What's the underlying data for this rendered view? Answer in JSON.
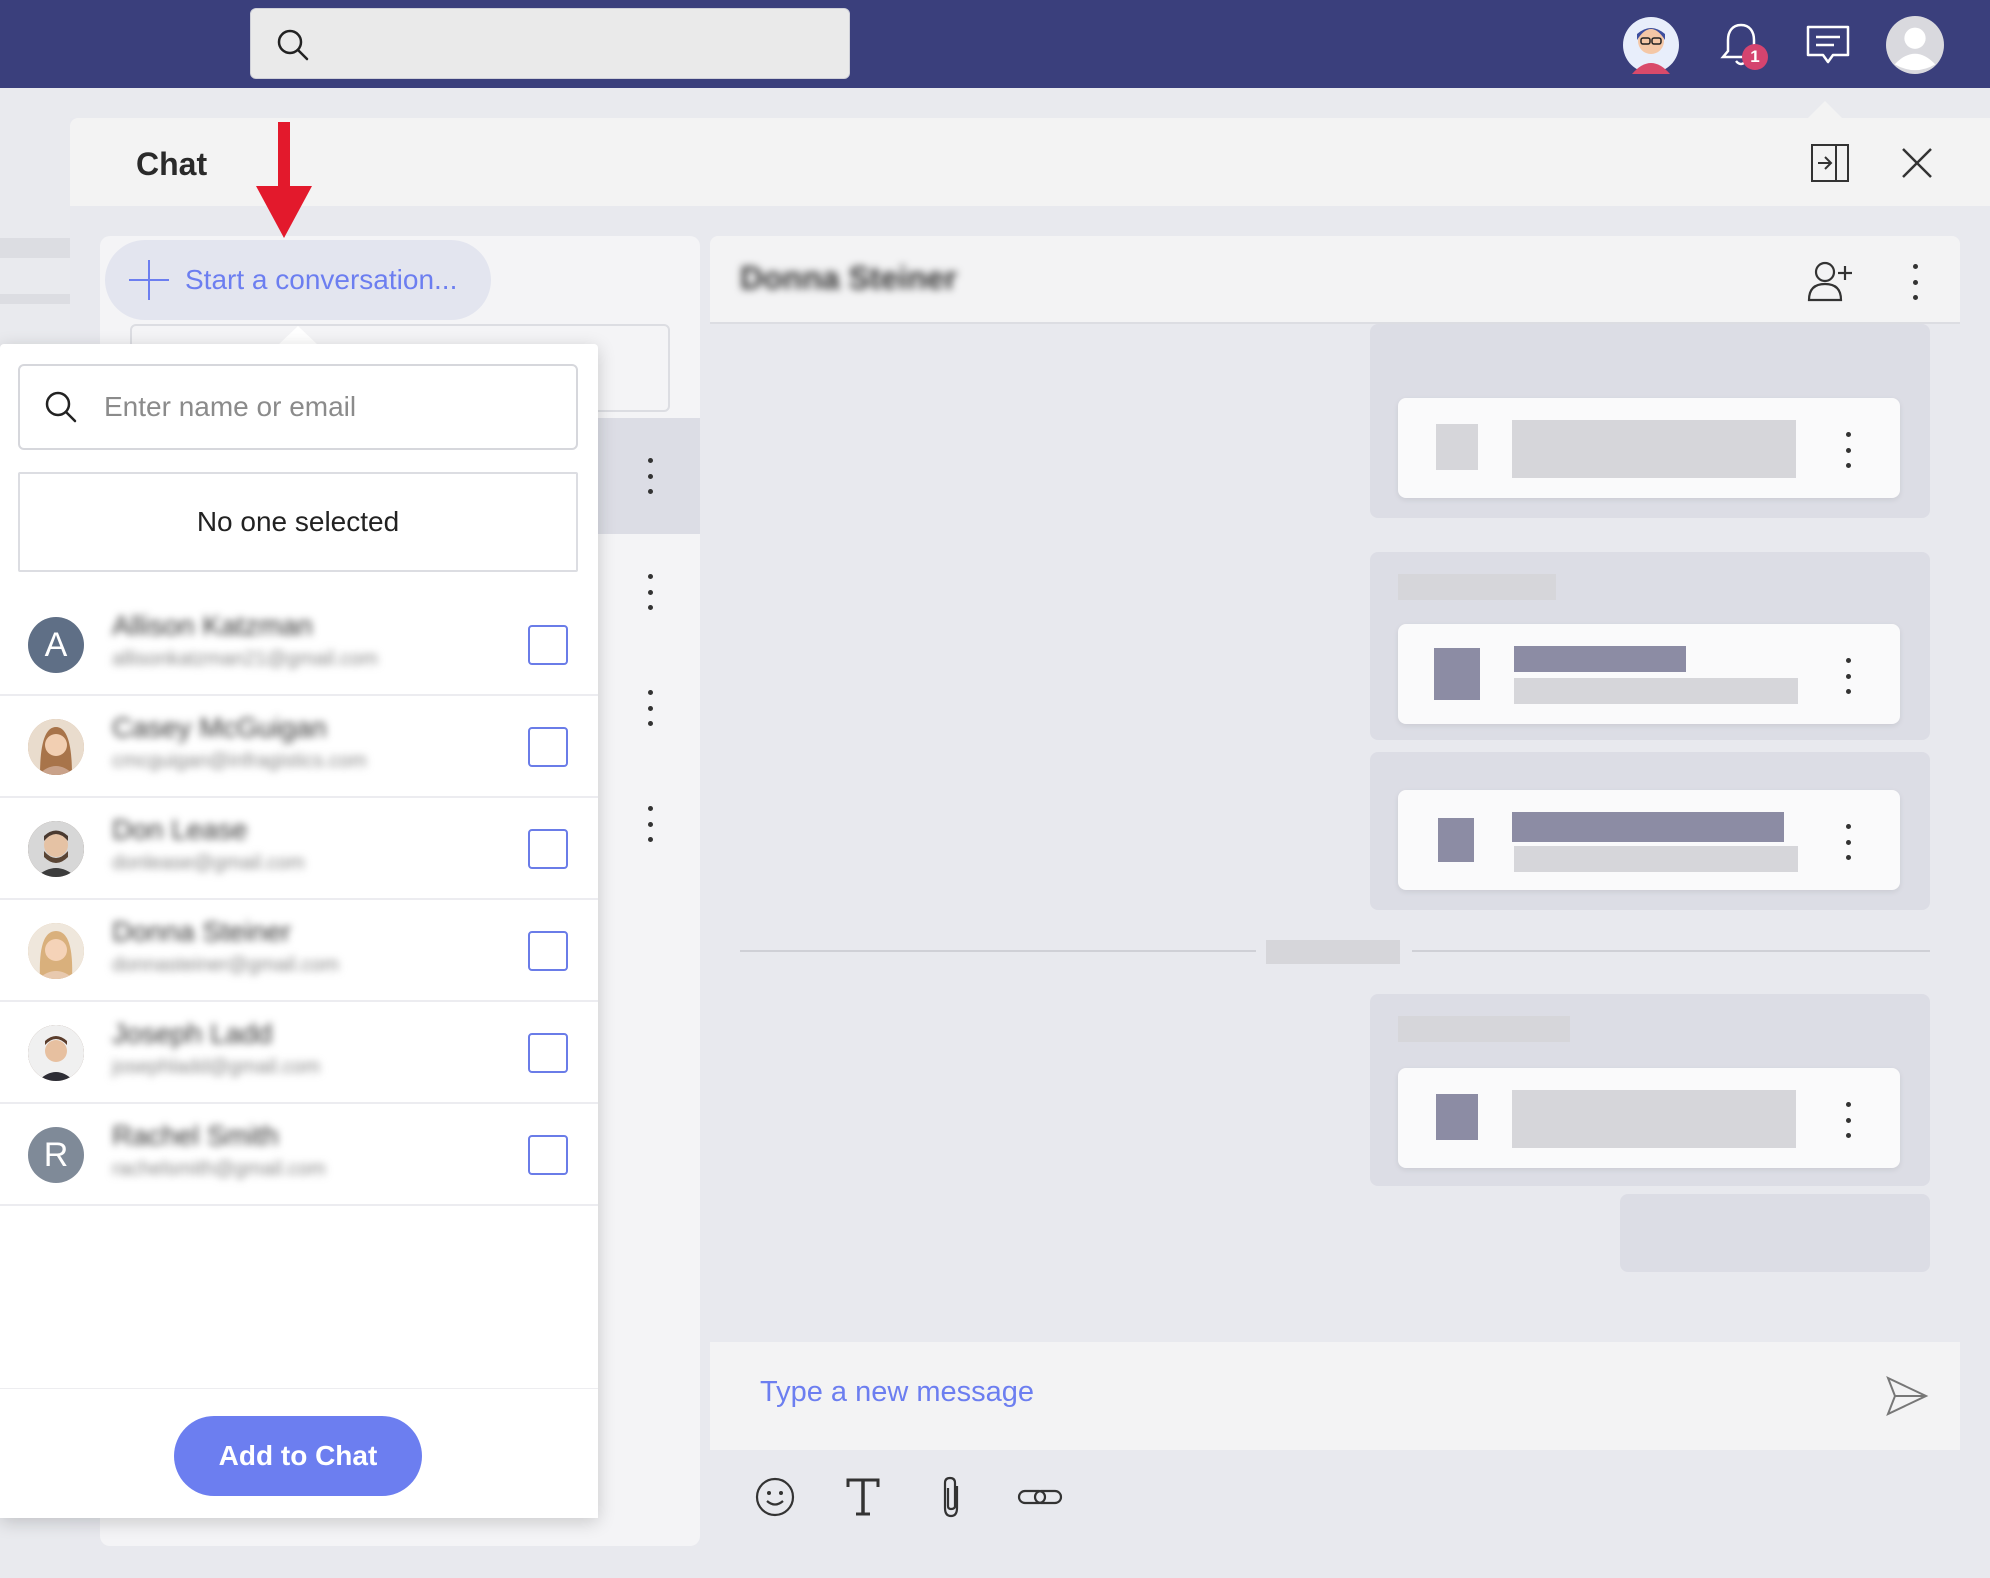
{
  "topbar": {
    "search_placeholder": "",
    "notification_count": "1"
  },
  "chat": {
    "title": "Chat",
    "start_conversation_label": "Start a conversation..."
  },
  "popup": {
    "search_placeholder": "Enter name or email",
    "no_one_selected": "No one selected",
    "contacts": [
      {
        "initial": "A",
        "name": "Allison Katzman",
        "email": "allisonkatzman21@gmail.com",
        "avatar_color": "#5f6f86"
      },
      {
        "initial": "",
        "name": "Casey McGuigan",
        "email": "cmcguigan@infragistics.com",
        "avatar_color": "#c89a72"
      },
      {
        "initial": "",
        "name": "Don Lease",
        "email": "donlease@gmail.com",
        "avatar_color": "#6d5b4e"
      },
      {
        "initial": "",
        "name": "Donna Steiner",
        "email": "donnasteiner@gmail.com",
        "avatar_color": "#d2a97d"
      },
      {
        "initial": "",
        "name": "Joseph Ladd",
        "email": "josephladd@gmail.com",
        "avatar_color": "#7a5a48"
      },
      {
        "initial": "R",
        "name": "Rachel Smith",
        "email": "rachelsmith@gmail.com",
        "avatar_color": "#7f8a98"
      }
    ],
    "add_button_label": "Add to Chat"
  },
  "conversation": {
    "name": "Donna Steiner",
    "composer_placeholder": "Type a new message"
  },
  "colors": {
    "topbar": "#3a3f7c",
    "accent": "#6c7ef0",
    "badge": "#d5446f"
  }
}
